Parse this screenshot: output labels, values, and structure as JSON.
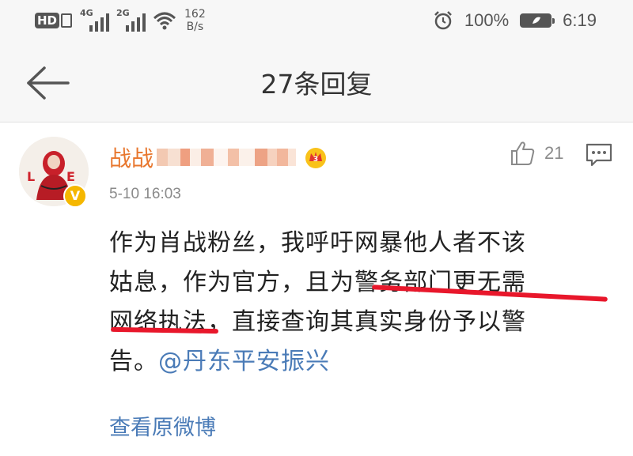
{
  "status_bar": {
    "hd_label": "HD",
    "signal_1_label": "4G",
    "signal_2_label": "2G",
    "speed_value": "162",
    "speed_unit": "B/s",
    "battery_percent": "100%",
    "time": "6:19",
    "icons": [
      "hd-icon",
      "signal-icon",
      "wifi-icon",
      "alarm-icon",
      "battery-icon"
    ]
  },
  "header": {
    "title": "27条回复",
    "back_icon": "arrow-left-icon"
  },
  "comment": {
    "username_visible": "战战",
    "username_obscured": true,
    "badge_icon": "crown-icon",
    "verified_icon": "verified-v-icon",
    "timestamp": "5-10 16:03",
    "like_count": "21",
    "body": {
      "line1": "作为肖战粉丝，我呼吁网暴他人者不该",
      "line2_a": "姑息，作为官方，且为",
      "line2_b": "警务部门更无需",
      "line3_a": "网络执法",
      "line3_b": "，直接查询其真实身份予以警",
      "line4_a": "告。",
      "mention": "@丹东平安振兴"
    },
    "view_original": "查看原微博"
  },
  "colors": {
    "username": "#e8772e",
    "link": "#4a7bb7",
    "annotation_red": "#e8172b",
    "meta_gray": "#8a8a8a"
  }
}
